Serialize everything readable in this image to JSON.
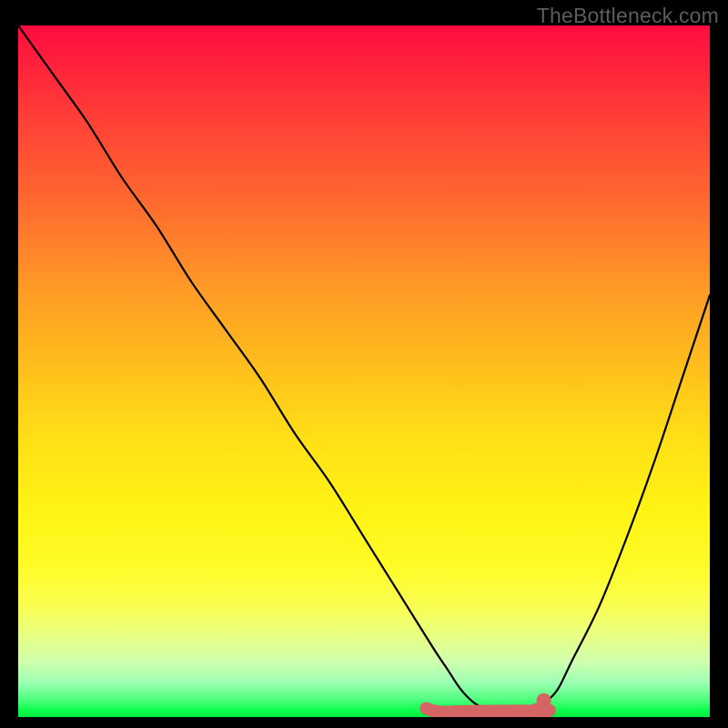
{
  "watermark": "TheBottleneck.com",
  "colors": {
    "background": "#000000",
    "curve": "#000000",
    "marker": "#d56464",
    "gradient_top": "#ff0b3e",
    "gradient_mid": "#fff314",
    "gradient_bottom": "#00e83e"
  },
  "chart_data": {
    "type": "line",
    "title": "",
    "xlabel": "",
    "ylabel": "",
    "xlim": [
      0,
      100
    ],
    "ylim": [
      0,
      100
    ],
    "note": "Axes unlabeled in source image; x is nominal 0–100 left→right, y is bottleneck % (0 at bottom, 100 at top). Values estimated from pixel positions.",
    "series": [
      {
        "name": "bottleneck-curve",
        "x": [
          0,
          5,
          10,
          15,
          20,
          25,
          30,
          35,
          40,
          45,
          50,
          55,
          60,
          62,
          64,
          66,
          68,
          70,
          72,
          74,
          76,
          78,
          80,
          84,
          88,
          92,
          96,
          100
        ],
        "y": [
          100,
          93,
          86,
          78,
          71,
          63,
          56,
          49,
          41,
          34,
          26,
          18,
          10,
          7,
          4,
          2,
          1,
          0.5,
          0.5,
          1,
          2,
          4,
          8,
          16,
          26,
          37,
          49,
          61
        ]
      }
    ],
    "optimal_range": {
      "description": "pink segment marking near-zero bottleneck region",
      "x_start": 59,
      "x_end": 75,
      "y": 1,
      "dot_x": 76,
      "dot_y": 2.4
    }
  }
}
